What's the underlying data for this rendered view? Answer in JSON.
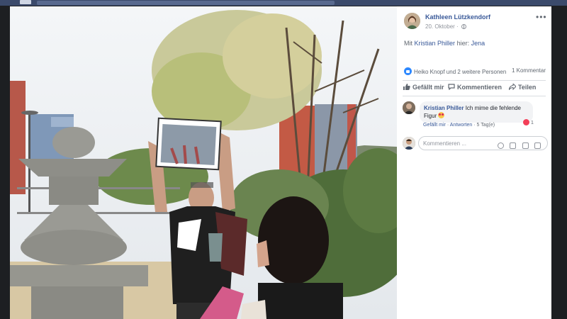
{
  "post": {
    "author": "Kathleen Lützkendorf",
    "date": "20. Oktober",
    "with_prefix": "Mit",
    "tagged": "Kristian Philler",
    "location_prefix": "hier:",
    "location": "Jena"
  },
  "reactions": {
    "summary": "Heiko Knopf und 2 weitere Personen",
    "comments_count": "1 Kommentar"
  },
  "actions": {
    "like": "Gefällt mir",
    "comment": "Kommentieren",
    "share": "Teilen"
  },
  "comment": {
    "author": "Kristian Philler",
    "text": "Ich mime die fehlende Figur",
    "like": "Gefällt mir",
    "separator": "·",
    "reply": "Antworten",
    "age": "5 Tag(e)",
    "reaction_count": "1"
  },
  "comment_input": {
    "placeholder": "Kommentieren ..."
  },
  "colors": {
    "link": "#385898",
    "like_blue": "#2d88ff",
    "love_red": "#f33e58"
  }
}
